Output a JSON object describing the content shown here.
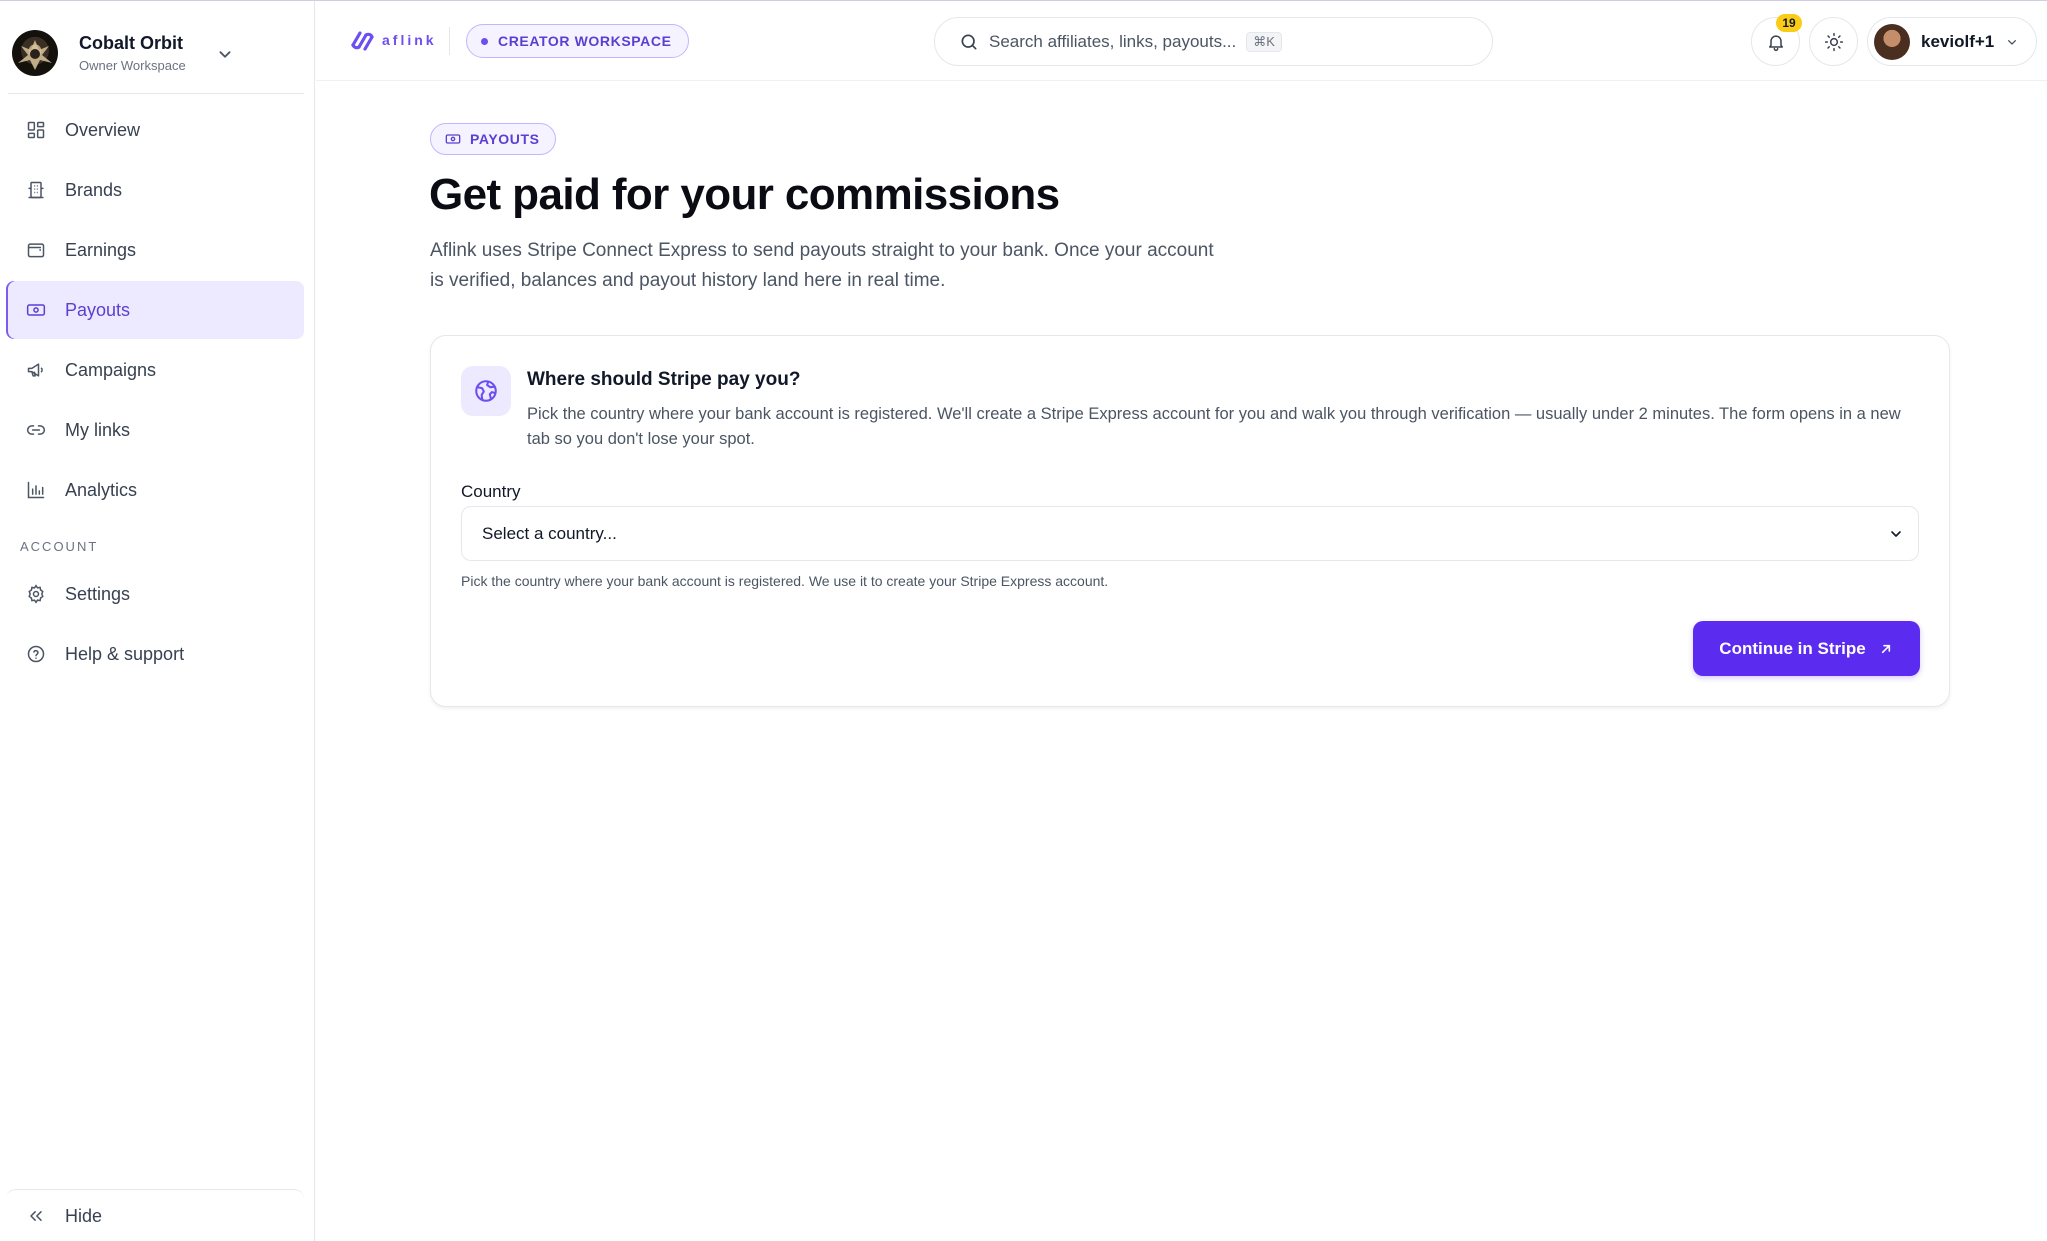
{
  "workspace": {
    "name": "Cobalt Orbit",
    "role": "Owner Workspace"
  },
  "nav": {
    "items": [
      {
        "label": "Overview",
        "icon": "grid-icon"
      },
      {
        "label": "Brands",
        "icon": "building-icon"
      },
      {
        "label": "Earnings",
        "icon": "wallet-icon"
      },
      {
        "label": "Payouts",
        "icon": "banknote-icon",
        "active": true
      },
      {
        "label": "Campaigns",
        "icon": "megaphone-icon"
      },
      {
        "label": "My links",
        "icon": "link-icon"
      },
      {
        "label": "Analytics",
        "icon": "bar-chart-icon"
      }
    ],
    "section_label": "ACCOUNT",
    "account_items": [
      {
        "label": "Settings",
        "icon": "gear-icon"
      },
      {
        "label": "Help & support",
        "icon": "help-circle-icon"
      }
    ],
    "hide_label": "Hide"
  },
  "topbar": {
    "logo_text": "aflink",
    "workspace_pill": "CREATOR WORKSPACE",
    "search_placeholder": "Search affiliates, links, payouts...",
    "search_shortcut": "⌘K",
    "notification_count": "19",
    "user_name": "keviolf+1"
  },
  "page": {
    "badge": "PAYOUTS",
    "title": "Get paid for your commissions",
    "description": "Aflink uses Stripe Connect Express to send payouts straight to your bank. Once your account is verified, balances and payout history land here in real time."
  },
  "card": {
    "title": "Where should Stripe pay you?",
    "description": "Pick the country where your bank account is registered. We'll create a Stripe Express account for you and walk you through verification — usually under 2 minutes. The form opens in a new tab so you don't lose your spot.",
    "field_label": "Country",
    "select_value": "Select a country...",
    "help_text": "Pick the country where your bank account is registered. We use it to create your Stripe Express account.",
    "cta_label": "Continue in Stripe"
  },
  "colors": {
    "accent": "#5b2bf0",
    "accent_light": "#ede9fe",
    "badge_yellow": "#facc15"
  }
}
